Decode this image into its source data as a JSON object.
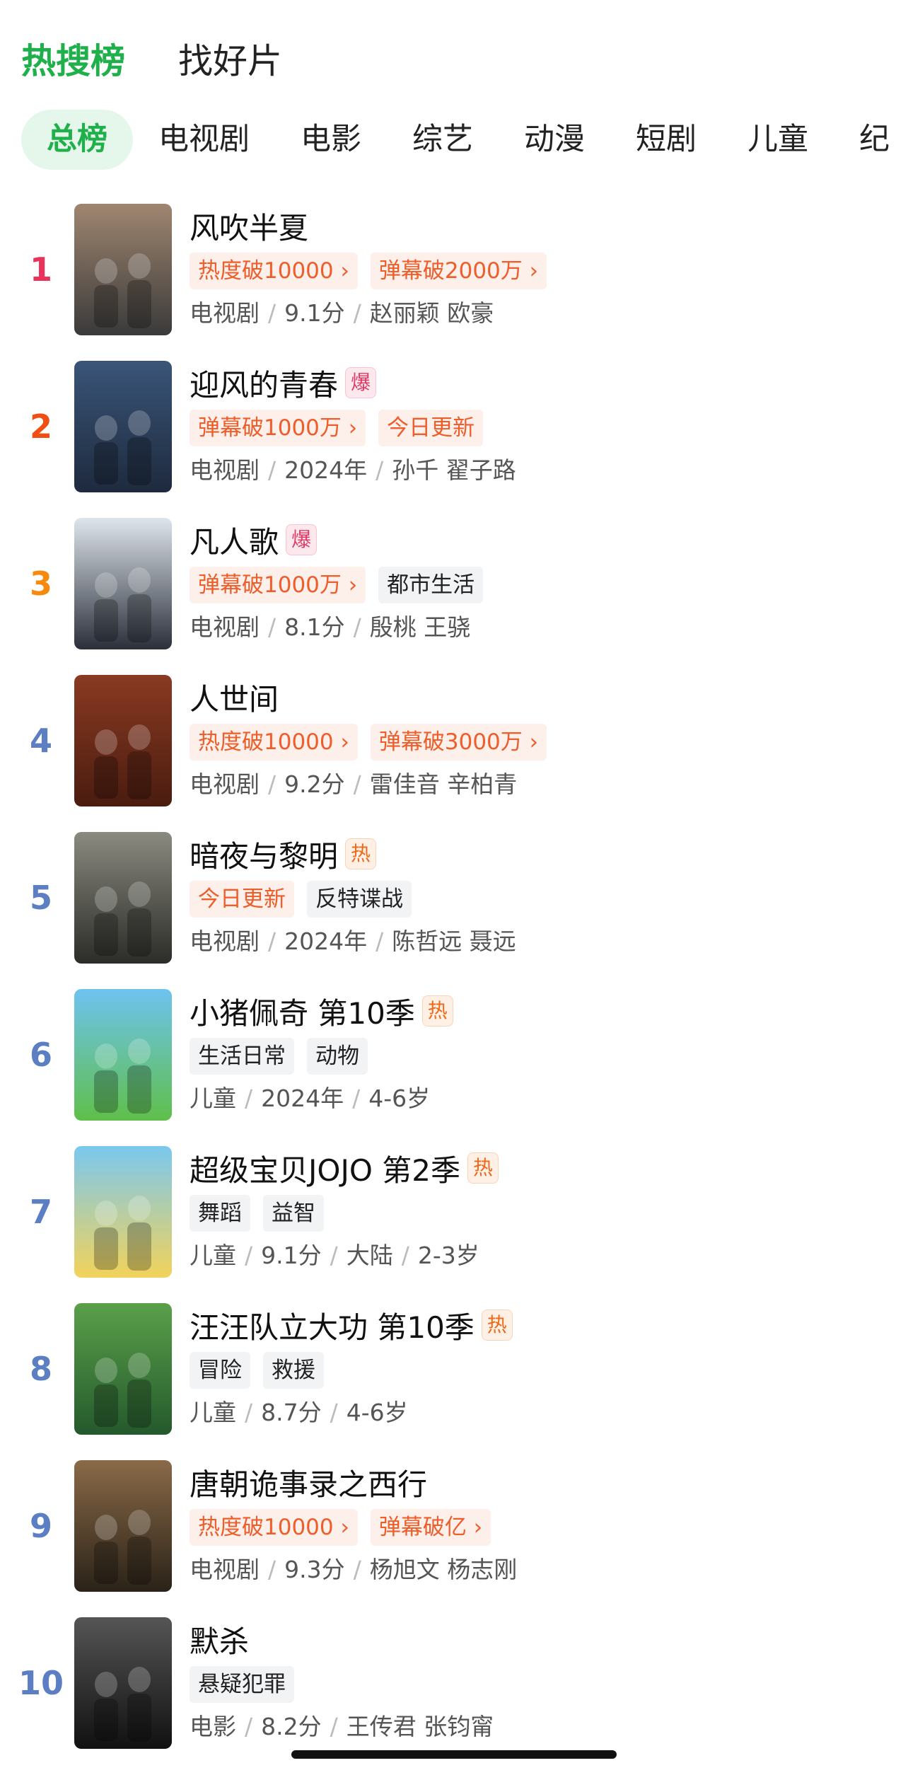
{
  "top_tabs": [
    {
      "label": "热搜榜",
      "active": true
    },
    {
      "label": "找好片",
      "active": false
    }
  ],
  "categories": [
    {
      "label": "总榜",
      "active": true
    },
    {
      "label": "电视剧"
    },
    {
      "label": "电影"
    },
    {
      "label": "综艺"
    },
    {
      "label": "动漫"
    },
    {
      "label": "短剧"
    },
    {
      "label": "儿童"
    },
    {
      "label": "纪"
    }
  ],
  "rank_colors": {
    "1": "#e9325c",
    "2": "#f04e13",
    "3": "#f58a0d",
    "other": "#5b7fc2"
  },
  "items": [
    {
      "rank": "1",
      "title": "风吹半夏",
      "badge": "",
      "tags": [
        {
          "text": "热度破10000 ›",
          "style": "hot"
        },
        {
          "text": "弹幕破2000万 ›",
          "style": "hot"
        }
      ],
      "meta": [
        "电视剧",
        "9.1分",
        "赵丽颖 欧豪"
      ]
    },
    {
      "rank": "2",
      "title": "迎风的青春",
      "badge": "爆",
      "tags": [
        {
          "text": "弹幕破1000万 ›",
          "style": "hot"
        },
        {
          "text": "今日更新",
          "style": "hot"
        }
      ],
      "meta": [
        "电视剧",
        "2024年",
        "孙千 翟子路"
      ]
    },
    {
      "rank": "3",
      "title": "凡人歌",
      "badge": "爆",
      "tags": [
        {
          "text": "弹幕破1000万 ›",
          "style": "hot"
        },
        {
          "text": "都市生活",
          "style": "plain"
        }
      ],
      "meta": [
        "电视剧",
        "8.1分",
        "殷桃 王骁"
      ]
    },
    {
      "rank": "4",
      "title": "人世间",
      "badge": "",
      "tags": [
        {
          "text": "热度破10000 ›",
          "style": "hot"
        },
        {
          "text": "弹幕破3000万 ›",
          "style": "hot"
        }
      ],
      "meta": [
        "电视剧",
        "9.2分",
        "雷佳音 辛柏青"
      ]
    },
    {
      "rank": "5",
      "title": "暗夜与黎明",
      "badge": "热",
      "tags": [
        {
          "text": "今日更新",
          "style": "hot"
        },
        {
          "text": "反特谍战",
          "style": "plain"
        }
      ],
      "meta": [
        "电视剧",
        "2024年",
        "陈哲远 聂远"
      ]
    },
    {
      "rank": "6",
      "title": "小猪佩奇 第10季",
      "badge": "热",
      "tags": [
        {
          "text": "生活日常",
          "style": "plain"
        },
        {
          "text": "动物",
          "style": "plain"
        }
      ],
      "meta": [
        "儿童",
        "2024年",
        "4-6岁"
      ]
    },
    {
      "rank": "7",
      "title": "超级宝贝JOJO 第2季",
      "badge": "热",
      "tags": [
        {
          "text": "舞蹈",
          "style": "plain"
        },
        {
          "text": "益智",
          "style": "plain"
        }
      ],
      "meta": [
        "儿童",
        "9.1分",
        "大陆",
        "2-3岁"
      ]
    },
    {
      "rank": "8",
      "title": "汪汪队立大功 第10季",
      "badge": "热",
      "tags": [
        {
          "text": "冒险",
          "style": "plain"
        },
        {
          "text": "救援",
          "style": "plain"
        }
      ],
      "meta": [
        "儿童",
        "8.7分",
        "4-6岁"
      ]
    },
    {
      "rank": "9",
      "title": "唐朝诡事录之西行",
      "badge": "",
      "tags": [
        {
          "text": "热度破10000 ›",
          "style": "hot"
        },
        {
          "text": "弹幕破亿 ›",
          "style": "hot"
        }
      ],
      "meta": [
        "电视剧",
        "9.3分",
        "杨旭文 杨志刚"
      ]
    },
    {
      "rank": "10",
      "title": "默杀",
      "badge": "",
      "tags": [
        {
          "text": "悬疑犯罪",
          "style": "plain"
        }
      ],
      "meta": [
        "电影",
        "8.2分",
        "王传君 张钧甯"
      ]
    }
  ],
  "posters": [
    {
      "top": "#a08670",
      "bottom": "#3a3a3a"
    },
    {
      "top": "#3a5578",
      "bottom": "#1e2a3e"
    },
    {
      "top": "#dfe5ec",
      "bottom": "#2a2f3a"
    },
    {
      "top": "#8a3a22",
      "bottom": "#4a1c10"
    },
    {
      "top": "#8a8a80",
      "bottom": "#2c2c28"
    },
    {
      "top": "#6ec3f0",
      "bottom": "#5fbf4a"
    },
    {
      "top": "#7ac8ef",
      "bottom": "#f2d35a"
    },
    {
      "top": "#5aa04a",
      "bottom": "#24592c"
    },
    {
      "top": "#8a6a48",
      "bottom": "#2a2218"
    },
    {
      "top": "#555555",
      "bottom": "#111111"
    }
  ]
}
